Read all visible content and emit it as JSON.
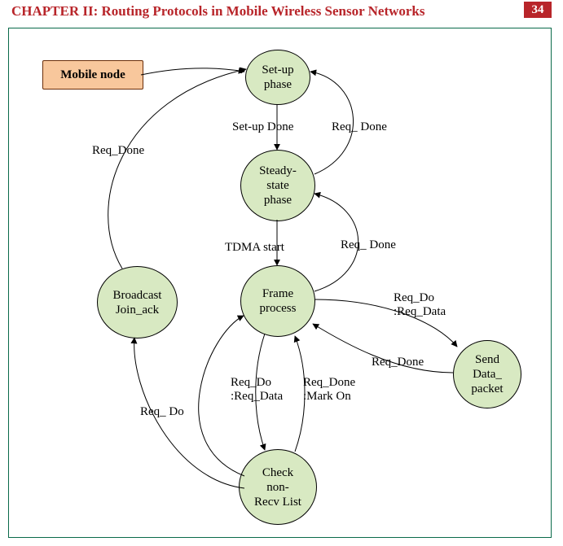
{
  "header": {
    "title": "CHAPTER II: Routing Protocols in Mobile Wireless Sensor Networks",
    "page_number": "34"
  },
  "legend": {
    "mobile_node": "Mobile node"
  },
  "states": {
    "setup": "Set-up\nphase",
    "steady": "Steady-\nstate\nphase",
    "frame": "Frame\nprocess",
    "broadcast": "Broadcast\nJoin_ack",
    "check": "Check\nnon-\nRecv List",
    "send": "Send\nData_\npacket"
  },
  "edges": {
    "setup_done": "Set-up Done",
    "req_done_1": "Req_ Done",
    "req_done_2": "Req_ Done",
    "tdma_start": "TDMA start",
    "req_done_3": "Req_Done",
    "req_do_req_data_1": "Req_Do\n:Req_Data",
    "req_do_req_data_2": "Req_Do\n:Req_Data",
    "req_done_mark_on": "Req_Done\n:Mark On",
    "req_done_4": "Req_Done",
    "req_do": "Req_ Do"
  }
}
